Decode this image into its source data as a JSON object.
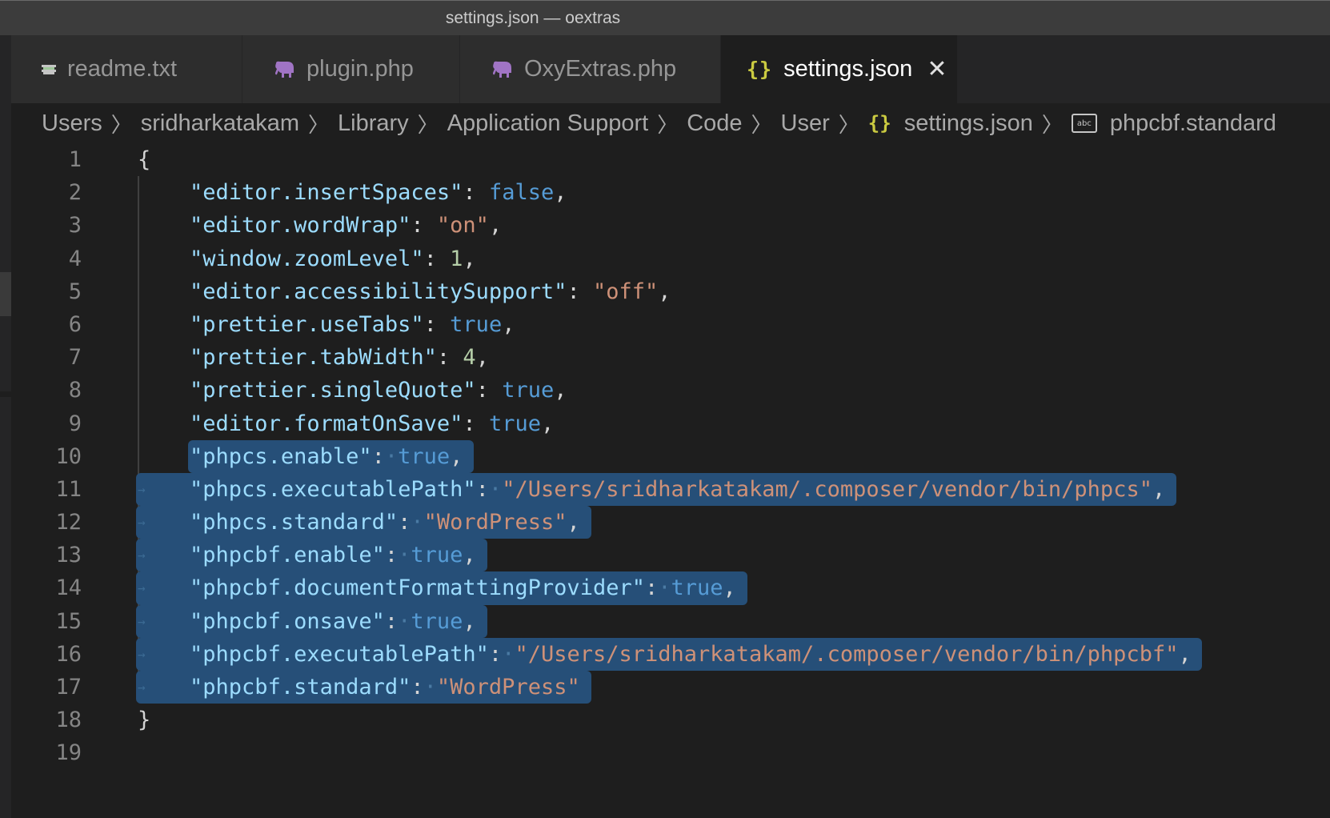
{
  "window": {
    "title": "settings.json — oextras"
  },
  "tabs": [
    {
      "label": "readme.txt",
      "icon": "lines-icon",
      "active": false
    },
    {
      "label": "plugin.php",
      "icon": "elephant-icon",
      "active": false
    },
    {
      "label": "OxyExtras.php",
      "icon": "elephant-icon",
      "active": false
    },
    {
      "label": "settings.json",
      "icon": "braces-icon",
      "active": true,
      "close": "✕"
    }
  ],
  "breadcrumb": [
    {
      "label": "Users"
    },
    {
      "label": "sridharkatakam"
    },
    {
      "label": "Library"
    },
    {
      "label": "Application Support"
    },
    {
      "label": "Code"
    },
    {
      "label": "User"
    },
    {
      "label": "settings.json",
      "icon": "braces-icon"
    },
    {
      "label": "phpcbf.standard",
      "icon": "string-abc-icon"
    }
  ],
  "icons": {
    "braces": "{}",
    "abc": "abc",
    "separator": "〉"
  },
  "colors": {
    "key": "#9cdcfe",
    "string": "#ce9178",
    "boolean": "#569cd6",
    "number": "#b5cea8",
    "selection": "#264f78",
    "json_icon": "#cbcb41",
    "php_icon": "#a074c4"
  },
  "editor": {
    "line_numbers": [
      "1",
      "2",
      "3",
      "4",
      "5",
      "6",
      "7",
      "8",
      "9",
      "10",
      "11",
      "12",
      "13",
      "14",
      "15",
      "16",
      "17",
      "18",
      "19"
    ],
    "lines": [
      {
        "text": "{"
      },
      {
        "key": "\"editor.insertSpaces\"",
        "value": "false",
        "type": "bool",
        "comma": ","
      },
      {
        "key": "\"editor.wordWrap\"",
        "value": "\"on\"",
        "type": "str",
        "comma": ","
      },
      {
        "key": "\"window.zoomLevel\"",
        "value": "1",
        "type": "num",
        "comma": ","
      },
      {
        "key": "\"editor.accessibilitySupport\"",
        "value": "\"off\"",
        "type": "str",
        "comma": ","
      },
      {
        "key": "\"prettier.useTabs\"",
        "value": "true",
        "type": "bool",
        "comma": ","
      },
      {
        "key": "\"prettier.tabWidth\"",
        "value": "4",
        "type": "num",
        "comma": ","
      },
      {
        "key": "\"prettier.singleQuote\"",
        "value": "true",
        "type": "bool",
        "comma": ","
      },
      {
        "key": "\"editor.formatOnSave\"",
        "value": "true",
        "type": "bool",
        "comma": ","
      },
      {
        "key": "\"phpcs.enable\"",
        "value": "true",
        "type": "bool",
        "comma": ",",
        "selected": true
      },
      {
        "key": "\"phpcs.executablePath\"",
        "value": "\"/Users/sridharkatakam/.composer/vendor/bin/phpcs\"",
        "type": "str",
        "comma": ",",
        "selected": true
      },
      {
        "key": "\"phpcs.standard\"",
        "value": "\"WordPress\"",
        "type": "str",
        "comma": ",",
        "selected": true
      },
      {
        "key": "\"phpcbf.enable\"",
        "value": "true",
        "type": "bool",
        "comma": ",",
        "selected": true
      },
      {
        "key": "\"phpcbf.documentFormattingProvider\"",
        "value": "true",
        "type": "bool",
        "comma": ",",
        "selected": true
      },
      {
        "key": "\"phpcbf.onsave\"",
        "value": "true",
        "type": "bool",
        "comma": ",",
        "selected": true
      },
      {
        "key": "\"phpcbf.executablePath\"",
        "value": "\"/Users/sridharkatakam/.composer/vendor/bin/phpcbf\"",
        "type": "str",
        "comma": ",",
        "selected": true
      },
      {
        "key": "\"phpcbf.standard\"",
        "value": "\"WordPress\"",
        "type": "str",
        "comma": "",
        "selected": true
      },
      {
        "text": "}"
      },
      {
        "text": ""
      }
    ]
  }
}
